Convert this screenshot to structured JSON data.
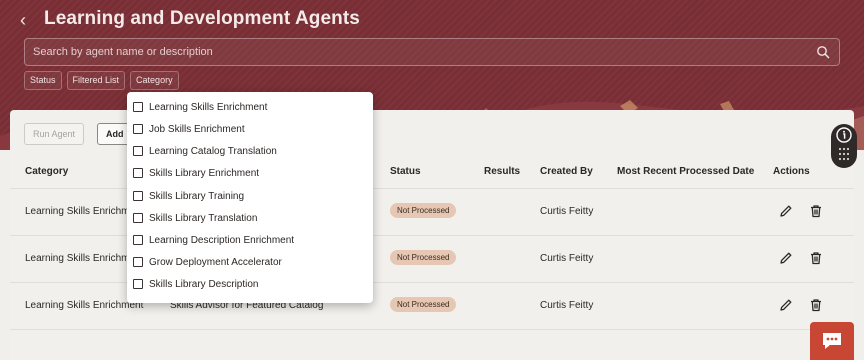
{
  "header": {
    "title": "Learning and Development Agents",
    "search_placeholder": "Search by agent name or description",
    "chips": [
      "Status",
      "Filtered List",
      "Category"
    ]
  },
  "toolbar": {
    "run_label": "Run Agent",
    "add_label": "Add"
  },
  "table": {
    "columns": [
      "Category",
      "Status",
      "Results",
      "Created By",
      "Most Recent Processed Date",
      "Actions"
    ],
    "rows": [
      {
        "category": "Learning Skills Enrichment",
        "name": "",
        "status": "Not Processed",
        "results": "",
        "created_by": "Curtis Feitty",
        "date": ""
      },
      {
        "category": "Learning Skills Enrichment",
        "name": "",
        "status": "Not Processed",
        "results": "",
        "created_by": "Curtis Feitty",
        "date": ""
      },
      {
        "category": "Learning Skills Enrichment",
        "name": "Skills Advisor for Featured Catalog",
        "status": "Not Processed",
        "results": "",
        "created_by": "Curtis Feitty",
        "date": ""
      }
    ]
  },
  "category_dropdown": {
    "options": [
      {
        "label": "Learning Skills Enrichment",
        "checked": false
      },
      {
        "label": "Job Skills Enrichment",
        "checked": false
      },
      {
        "label": "Learning Catalog Translation",
        "checked": false
      },
      {
        "label": "Skills Library Enrichment",
        "checked": false
      },
      {
        "label": "Skills Library Training",
        "checked": false
      },
      {
        "label": "Skills Library Translation",
        "checked": false
      },
      {
        "label": "Learning Description Enrichment",
        "checked": false
      },
      {
        "label": "Grow Deployment Accelerator",
        "checked": false
      },
      {
        "label": "Skills Library Description",
        "checked": false
      }
    ]
  },
  "colors": {
    "header_bg": "#7a2f35",
    "status_badge": "#e6c7b3",
    "chat_button": "#c74634"
  },
  "icons": {
    "back": "chevron-left-icon",
    "search": "search-icon",
    "edit": "pencil-icon",
    "delete": "trash-icon",
    "info": "info-icon",
    "grid": "grid-icon",
    "chat": "chat-icon"
  }
}
